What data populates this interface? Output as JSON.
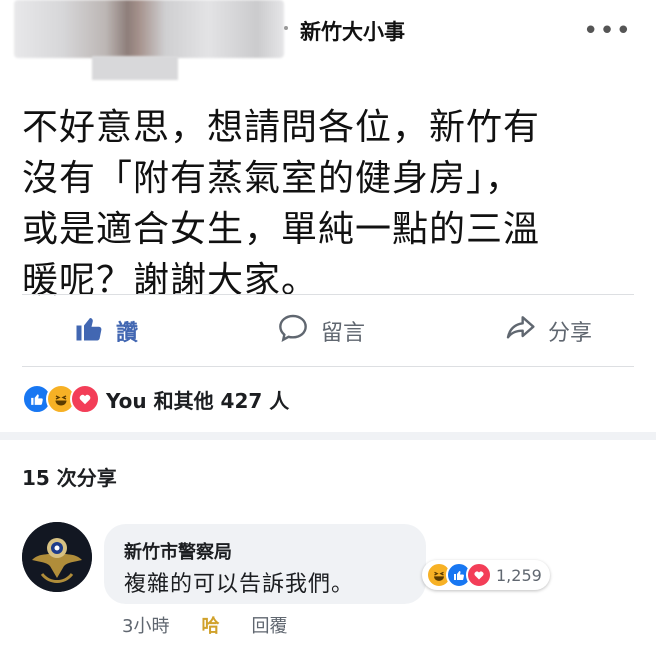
{
  "post": {
    "author": "新竹大小事",
    "text_lines": [
      "不好意思，想請問各位，新竹有",
      "沒有「附有蒸氣室的健身房」，",
      "或是適合女生，單純一點的三溫",
      "暖呢？謝謝大家。"
    ]
  },
  "actions": {
    "like": "讚",
    "comment": "留言",
    "share": "分享"
  },
  "reactions": {
    "summary": "You 和其他 427 人"
  },
  "shares": "15 次分享",
  "comment": {
    "author": "新竹市警察局",
    "text": "複雜的可以告訴我們。",
    "reaction_count": "1,259",
    "time": "3小時",
    "haha": "哈",
    "reply": "回覆"
  },
  "colors": {
    "like_blue": "#4267b2",
    "haha": "#f7b125",
    "love": "#f33e58"
  }
}
